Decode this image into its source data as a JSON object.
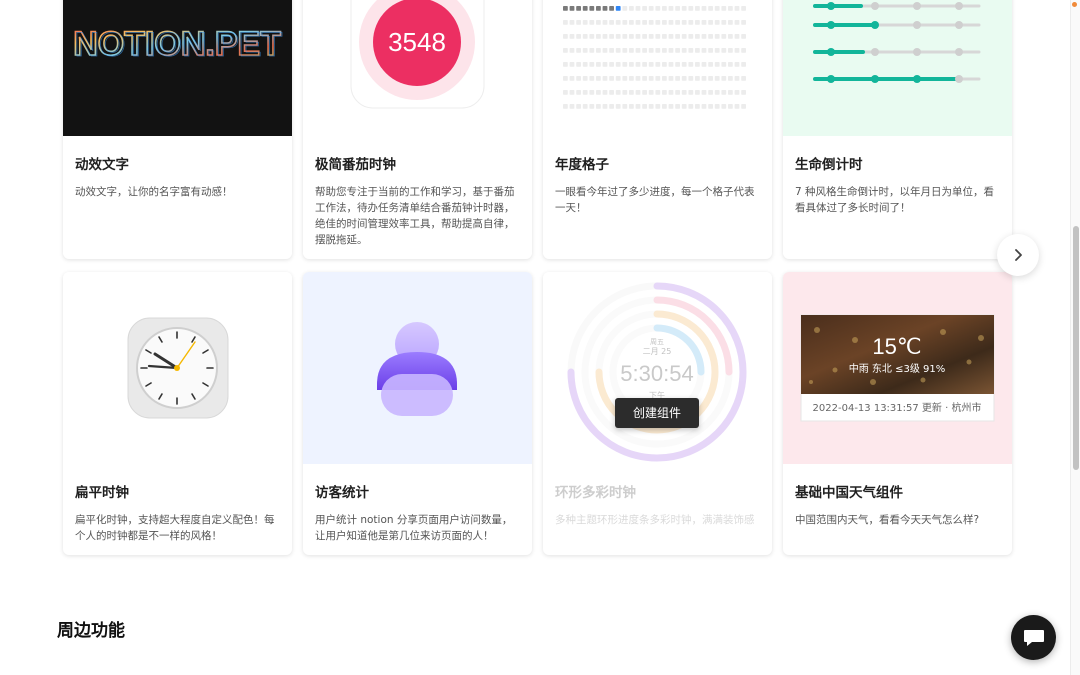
{
  "widgets": [
    {
      "title": "动效文字",
      "desc": "动效文字，让你的名字富有动感！",
      "preview_text": "NOTION.PET",
      "bg": "#121212"
    },
    {
      "title": "极简番茄时钟",
      "desc": "帮助您专注于当前的工作和学习，基于番茄工作法，待办任务清单结合番茄钟计时器，绝佳的时间管理效率工具，帮助提高自律，摆脱拖延。",
      "preview_text": "3548",
      "accent": "#ec2f62"
    },
    {
      "title": "年度格子",
      "desc": "一眼看今年过了多少进度，每一个格子代表一天！",
      "accent": "#2f86f6"
    },
    {
      "title": "生命倒计时",
      "desc": "7 种风格生命倒计时，以年月日为单位，看看具体过了多长时间了！",
      "accent": "#12b59a",
      "bg": "#e9fbf1"
    },
    {
      "title": "扁平时钟",
      "desc": "扁平化时钟，支持超大程度自定义配色！每个人的时钟都是不一样的风格！"
    },
    {
      "title": "访客统计",
      "desc": "用户统计 notion 分享页面用户访问数量，让用户知道他是第几位来访页面的人！",
      "accent": "#7a5af5",
      "bg": "#eef3ff"
    },
    {
      "title": "环形多彩时钟",
      "desc": "多种主题环形进度条多彩时钟，满满装饰感",
      "preview": {
        "week": "周五",
        "date": "二月 25",
        "time": "5:30:54",
        "period": "下午"
      },
      "action_label": "创建组件"
    },
    {
      "title": "基础中国天气组件",
      "desc": "中国范围内天气，看看今天天气怎么样?",
      "preview": {
        "temp": "15℃",
        "condition": "中雨 东北 ≤3级 91%",
        "updated": "2022-04-13 13:31:57 更新 · 杭州市"
      },
      "bg": "#fde8ec"
    }
  ],
  "section_title": "周边功能",
  "icons": {
    "next": "chevron-right-icon",
    "chat": "chat-bubble-icon"
  },
  "colors": {
    "scroll_thumb": "#c2c2c2",
    "chat_button": "#1a1a1a"
  }
}
